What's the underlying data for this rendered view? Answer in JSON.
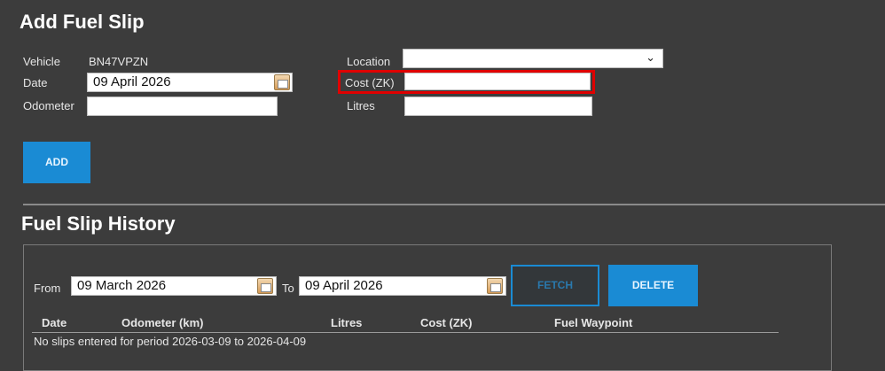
{
  "add_form": {
    "title": "Add Fuel Slip",
    "vehicle_label": "Vehicle",
    "vehicle_value": "BN47VPZN",
    "date_label": "Date",
    "date_value": "09 April 2026",
    "odometer_label": "Odometer",
    "odometer_value": "",
    "location_label": "Location",
    "location_selected": "",
    "cost_label": "Cost (ZK)",
    "cost_value": "",
    "litres_label": "Litres",
    "litres_value": "",
    "add_button": "ADD"
  },
  "history": {
    "title": "Fuel Slip History",
    "from_label": "From",
    "from_value": "09 March 2026",
    "to_label": "To",
    "to_value": "09 April 2026",
    "fetch_button": "FETCH",
    "delete_button": "DELETE",
    "columns": [
      "Date",
      "Odometer (km)",
      "Litres",
      "Cost (ZK)",
      "Fuel Waypoint"
    ],
    "empty_message": "No slips entered for period 2026-03-09 to 2026-04-09"
  },
  "colors": {
    "background": "#3c3c3c",
    "accent": "#1a8bd4",
    "highlight": "#e00000"
  }
}
